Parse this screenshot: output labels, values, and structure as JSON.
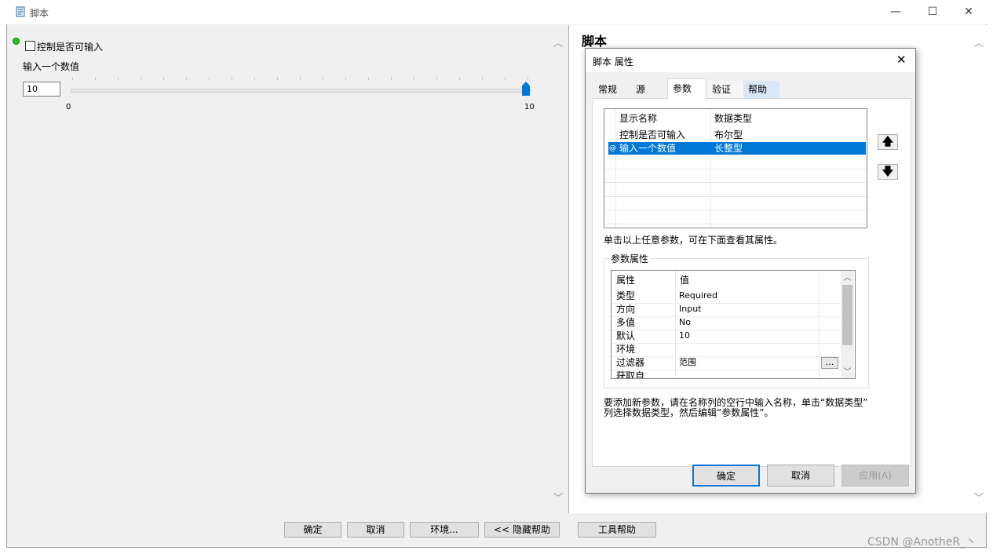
{
  "window": {
    "title": "脚本",
    "minimize": "—",
    "maximize": "☐",
    "close": "✕"
  },
  "left_pane": {
    "checkbox_label": "控制是否可输入",
    "checkbox_checked": false,
    "slider_label": "输入一个数值",
    "number_value": "10",
    "slider_min": "0",
    "slider_max": "10",
    "slider_level": 1.0
  },
  "right_pane": {
    "help_heading": "脚本"
  },
  "bottom_buttons": {
    "ok": "确定",
    "cancel": "取消",
    "env": "环境...",
    "hide_help": "<< 隐藏帮助",
    "tool_help": "工具帮助"
  },
  "dialog": {
    "title": "脚本 属性",
    "close": "✕",
    "tabs": [
      "常规",
      "源",
      "参数",
      "验证",
      "帮助"
    ],
    "active_tab": "参数",
    "param_table": {
      "headers": [
        "显示名称",
        "数据类型"
      ],
      "rows": [
        {
          "name": "控制是否可输入",
          "type": "布尔型"
        },
        {
          "name": "输入一个数值",
          "type": "长整型",
          "selected": true,
          "marker": "@"
        }
      ]
    },
    "hint_text": "单击以上任意参数，可在下面查看其属性。",
    "group_label": "参数属性",
    "props_table": {
      "headers": [
        "属性",
        "值"
      ],
      "rows": [
        {
          "key": "类型",
          "value": "Required"
        },
        {
          "key": "方向",
          "value": "Input"
        },
        {
          "key": "多值",
          "value": "No"
        },
        {
          "key": "默认",
          "value": "10"
        },
        {
          "key": "环境",
          "value": ""
        },
        {
          "key": "过滤器",
          "value": "范围"
        },
        {
          "key": "获取自",
          "value": ""
        }
      ],
      "browse_button": "..."
    },
    "footer_text_1": "要添加新参数，请在名称列的空行中输入名称，单击“数据类型”",
    "footer_text_2": "列选择数据类型，然后编辑“参数属性”。",
    "ok": "确定",
    "cancel": "取消",
    "apply": "应用(A)"
  },
  "watermark": "CSDN @AnotheR_丶",
  "colors": {
    "selection": "#0078d7",
    "slider_thumb": "#0078d7",
    "green_dot": "#22c022"
  }
}
